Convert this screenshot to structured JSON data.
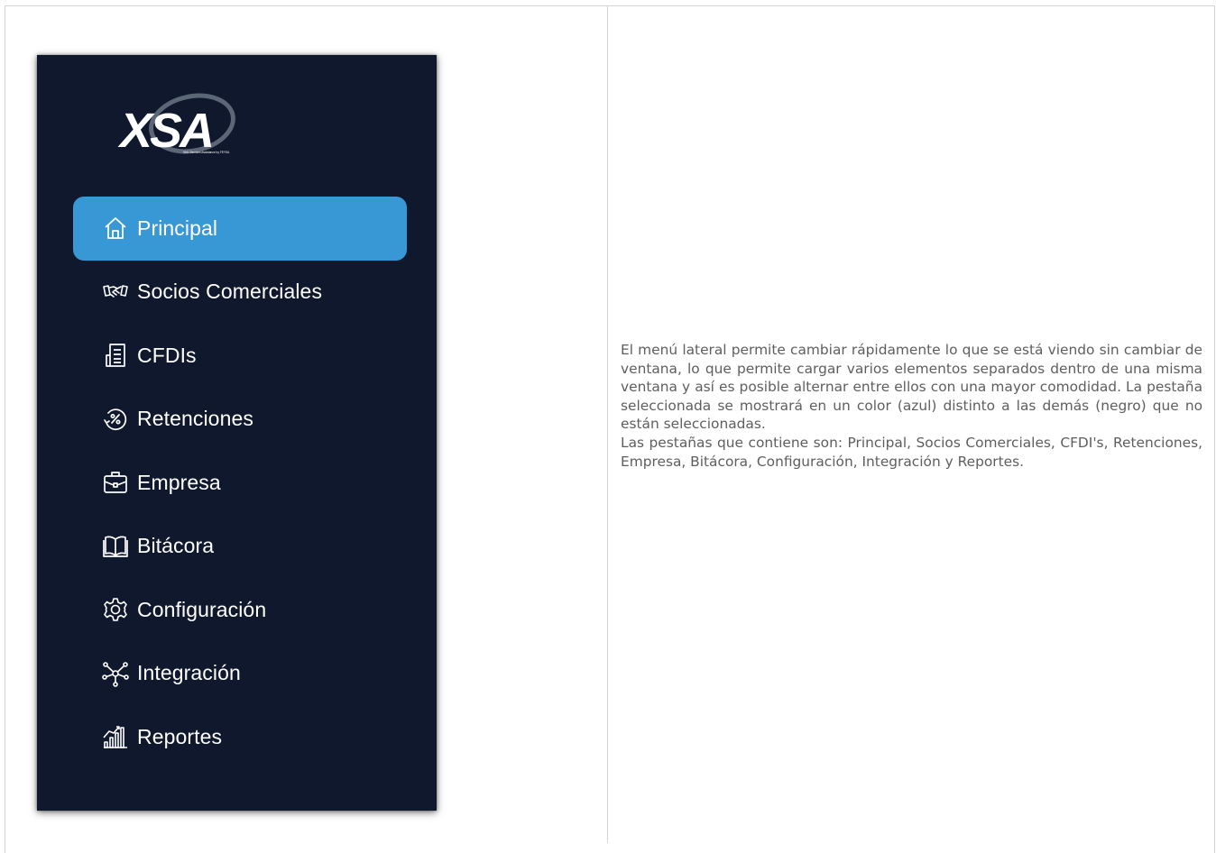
{
  "logo": {
    "text": "XSA",
    "tagline": "XML Services Assistance by FEYSA"
  },
  "colors": {
    "sidebar_bg": "#0f182c",
    "active_bg": "#3898d6",
    "text": "#ffffff"
  },
  "menu": {
    "items": [
      {
        "label": "Principal",
        "icon": "home-icon",
        "active": true
      },
      {
        "label": "Socios Comerciales",
        "icon": "handshake-icon",
        "active": false
      },
      {
        "label": "CFDIs",
        "icon": "document-icon",
        "active": false
      },
      {
        "label": "Retenciones",
        "icon": "percent-icon",
        "active": false
      },
      {
        "label": "Empresa",
        "icon": "briefcase-icon",
        "active": false
      },
      {
        "label": "Bitácora",
        "icon": "book-icon",
        "active": false
      },
      {
        "label": "Configuración",
        "icon": "gear-icon",
        "active": false
      },
      {
        "label": "Integración",
        "icon": "network-icon",
        "active": false
      },
      {
        "label": "Reportes",
        "icon": "chart-icon",
        "active": false
      }
    ]
  },
  "description": {
    "paragraph1": "El menú lateral permite cambiar rápidamente lo que se está viendo sin cambiar de ventana, lo que permite cargar varios elementos separados dentro de una misma ventana y así es posible alternar entre ellos con una mayor comodidad. La pestaña seleccionada se mostrará en un color (azul) distinto a las demás (negro) que no están seleccionadas.",
    "paragraph2": "Las pestañas que contiene son: Principal, Socios Comerciales, CFDI's, Retenciones, Empresa, Bitácora, Configuración, Integración y Reportes."
  }
}
